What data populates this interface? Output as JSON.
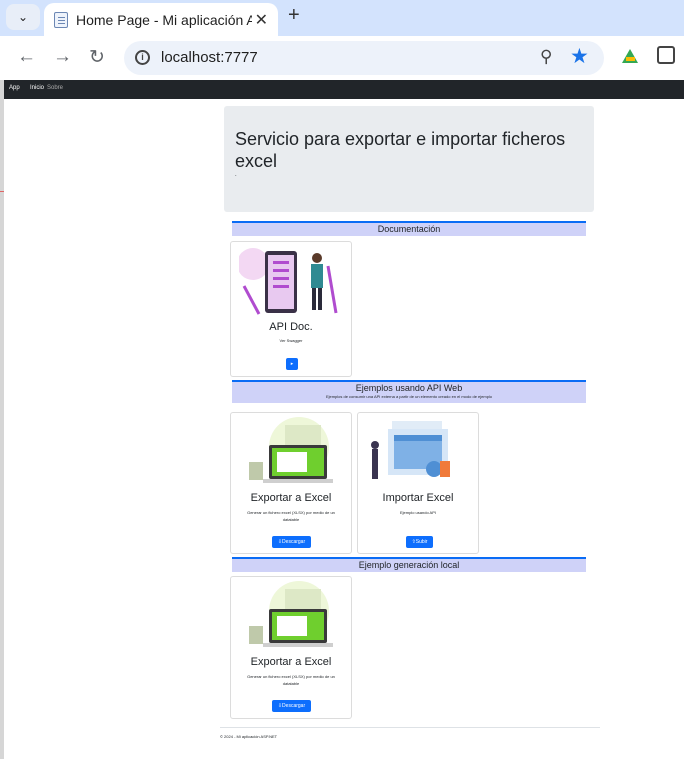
{
  "browser": {
    "tab_title": "Home Page - Mi aplicación ASP.NET",
    "tab_menu_icon": "chevron-down-icon",
    "new_tab": "+",
    "close": "✕",
    "url": "localhost:7777",
    "back": "←",
    "forward": "→",
    "reload": "↻"
  },
  "navbar": {
    "brand": "App",
    "items": [
      "Inicio",
      "Sobre"
    ]
  },
  "jumbotron": {
    "title": "Servicio para exportar e importar ficheros excel",
    "subtitle": "."
  },
  "sections": {
    "docs": {
      "title": "Documentación"
    },
    "api": {
      "title": "Ejemplos usando API Web",
      "subtitle": "Ejemplos de consumir una API externa a partir de un elemento creado en el modo de ejemplo"
    },
    "local": {
      "title": "Ejemplo generación local"
    }
  },
  "cards": {
    "api_doc": {
      "title": "API Doc.",
      "text": "Ver Swagger",
      "button": "▸"
    },
    "export": {
      "title": "Exportar a Excel",
      "text": "Generar un fichero excel (XLSX) por medio de un datatable",
      "button": "⇩Descargar"
    },
    "import": {
      "title": "Importar Excel",
      "text": "Ejemplo usando API",
      "button": "⇧Subir"
    },
    "export_local": {
      "title": "Exportar a Excel",
      "text": "Generar un fichero excel (XLSX) por medio de un datatable",
      "button": "⇩Descargar"
    }
  },
  "footer": {
    "text": "© 2024 - Mi aplicación ASP.NET"
  },
  "colors": {
    "primary": "#0d6efd",
    "section_bg": "#cfd2f8",
    "navbar": "#212529",
    "jumbotron": "#e9ecef"
  }
}
